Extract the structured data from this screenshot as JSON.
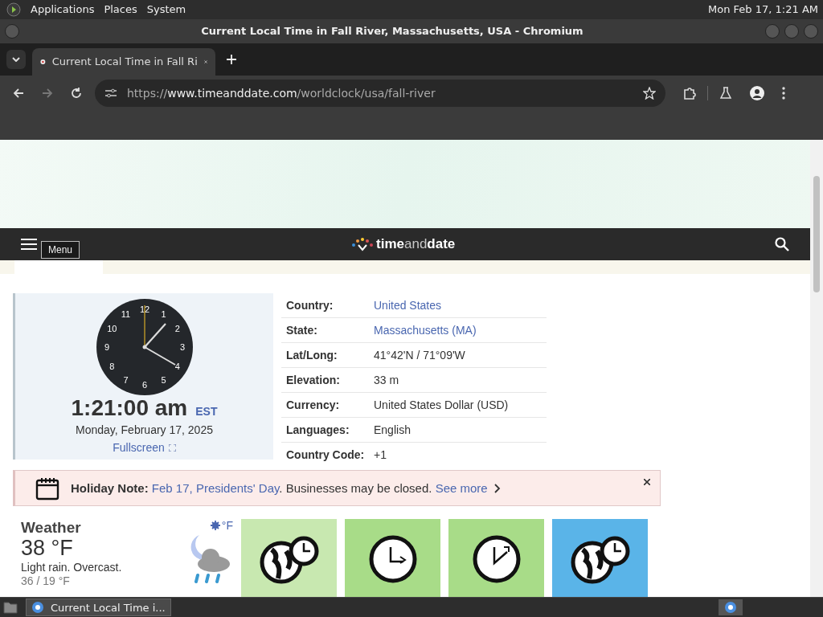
{
  "top_panel": {
    "menus": [
      "Applications",
      "Places",
      "System"
    ],
    "clock": "Mon Feb 17, 1:21 AM"
  },
  "window": {
    "title": "Current Local Time in Fall River, Massachusetts, USA - Chromium"
  },
  "browser": {
    "tabs": [
      {
        "label": "Current Local Time in Fall Ri",
        "selected": true
      }
    ],
    "url": {
      "scheme": "https://",
      "host": "www.timeanddate.com",
      "path": "/worldclock/usa/fall-river"
    }
  },
  "site": {
    "logo": {
      "part_1": "time",
      "part_2": "and",
      "part_3": "date"
    },
    "menu_tooltip": "Menu"
  },
  "clock": {
    "numerals": [
      "12",
      "1",
      "2",
      "3",
      "4",
      "5",
      "6",
      "7",
      "8",
      "9",
      "10",
      "11"
    ],
    "time": "1:21:00 am",
    "zone": "EST",
    "date": "Monday, February 17, 2025",
    "fullscreen": "Fullscreen"
  },
  "info": [
    {
      "label": "Country:",
      "value": "United States",
      "link": true
    },
    {
      "label": "State:",
      "value": "Massachusetts (MA)",
      "link": true
    },
    {
      "label": "Lat/Long:",
      "value": "41°42'N / 71°09'W",
      "link": false
    },
    {
      "label": "Elevation:",
      "value": "33 m",
      "link": false
    },
    {
      "label": "Currency:",
      "value": "United States Dollar (USD)",
      "link": false
    },
    {
      "label": "Languages:",
      "value": "English",
      "link": false
    },
    {
      "label": "Country Code:",
      "value": "+1",
      "link": false
    }
  ],
  "holiday": {
    "label": "Holiday Note:",
    "link": "Feb 17, Presidents' Day",
    "text": ". Businesses may be closed.",
    "more": "See more"
  },
  "weather": {
    "title": "Weather",
    "temperature": "38 °F",
    "condition": "Light rain. Overcast.",
    "range": "36 / 19 °F",
    "unit": "°F"
  },
  "tiles": [
    {
      "kind": "globe",
      "color": "#c8e8b0"
    },
    {
      "kind": "clock",
      "color": "#a8dc88"
    },
    {
      "kind": "clock-arrow",
      "color": "#a8dc88"
    },
    {
      "kind": "globe",
      "color": "#5ab4e8"
    }
  ],
  "taskbar": {
    "window": "Current Local Time i..."
  }
}
